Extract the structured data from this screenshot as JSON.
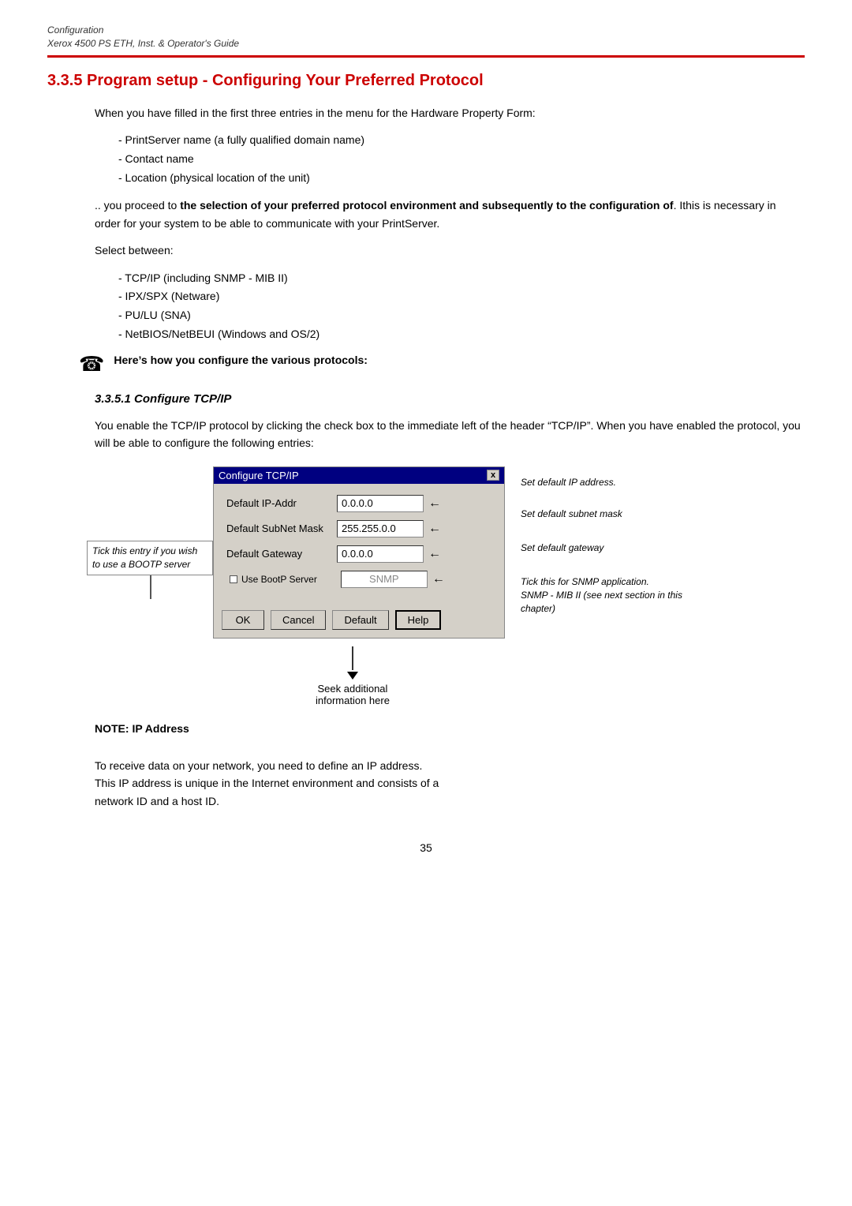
{
  "header": {
    "line1": "Configuration",
    "line2": "Xerox 4500 PS ETH, Inst. & Operator's Guide"
  },
  "section": {
    "number": "3.3.5",
    "title": "Program setup - Configuring Your Preferred Protocol"
  },
  "intro": {
    "para1": "When you have filled in the first three entries in the menu for the Hardware Property Form:",
    "bullets1": [
      "- PrintServer name (a fully qualified domain name)",
      "- Contact name",
      "- Location (physical location of the unit)"
    ],
    "para2_prefix": ".. you proceed to ",
    "para2_bold": "the selection of your preferred protocol environment and subsequently to the configuration of",
    "para2_suffix": ". Ithis is necessary in order for your system to be able to communicate with your PrintServer.",
    "para3": "Select between:",
    "bullets2": [
      "- TCP/IP  (including SNMP - MIB II)",
      "- IPX/SPX (Netware)",
      "- PU/LU (SNA)",
      "- NetBIOS/NetBEUI (Windows and OS/2)"
    ]
  },
  "note_icon": "☎",
  "note_text": "Here’s how you configure the various protocols:",
  "subsection": {
    "number": "3.3.5.1",
    "title": "Configure TCP/IP"
  },
  "tcpip_intro": "You enable the TCP/IP protocol by clicking the check box to the immediate left of the header “TCP/IP”. When you have enabled the protocol, you will be able to configure the following entries:",
  "dialog": {
    "title": "Configure TCP/IP",
    "close_btn": "x",
    "rows": [
      {
        "label": "Default IP-Addr",
        "value": "0.0.0.0"
      },
      {
        "label": "Default SubNet Mask",
        "value": "255.255.0.0"
      },
      {
        "label": "Default Gateway",
        "value": "0.0.0.0"
      }
    ],
    "checkbox_label": "Use BootP Server",
    "snmp_label": "SNMP",
    "buttons": [
      {
        "label": "OK",
        "highlight": false
      },
      {
        "label": "Cancel",
        "highlight": false
      },
      {
        "label": "Default",
        "highlight": false
      },
      {
        "label": "Help",
        "highlight": true
      }
    ]
  },
  "annotations_right": [
    "Set default IP address.",
    "Set default subnet mask",
    "Set default gateway",
    "Tick this for SNMP application.\nSNMP - MIB II (see next section in this chapter)"
  ],
  "annotation_left": "Tick this entry if you wish to use a BOOTP server",
  "seek_annotation": "Seek  additional\ninformation here",
  "note_ip": {
    "title": "NOTE:   IP Address",
    "body": "To receive data on your network, you need to define an IP address.\nThis IP address is unique in the Internet environment and consists of a\nnetwork ID and a host ID."
  },
  "page_number": "35"
}
